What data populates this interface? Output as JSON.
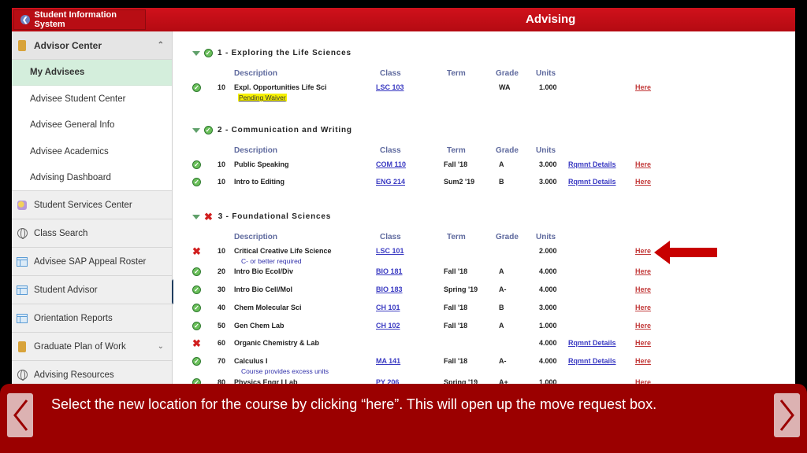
{
  "topbar": {
    "back_label": "Student Information System",
    "page_title": "Advising"
  },
  "sidebar": {
    "header": "Advisor Center",
    "sub_items": [
      {
        "label": "My Advisees",
        "active": true
      },
      {
        "label": "Advisee Student Center"
      },
      {
        "label": "Advisee General Info"
      },
      {
        "label": "Advisee Academics"
      },
      {
        "label": "Advising Dashboard"
      }
    ],
    "items": [
      {
        "label": "Student Services Center",
        "icon": "people-icon"
      },
      {
        "label": "Class Search",
        "icon": "globe-icon"
      },
      {
        "label": "Advisee SAP Appeal Roster",
        "icon": "grid-icon"
      },
      {
        "label": "Student Advisor",
        "icon": "grid-icon"
      },
      {
        "label": "Orientation Reports",
        "icon": "grid-icon"
      },
      {
        "label": "Graduate Plan of Work",
        "icon": "book-icon"
      },
      {
        "label": "Advising Resources",
        "icon": "globe-icon"
      }
    ],
    "collapse_label": "II"
  },
  "columns": {
    "description": "Description",
    "class": "Class",
    "term": "Term",
    "grade": "Grade",
    "units": "Units"
  },
  "requirements": [
    {
      "title": "1 - Exploring the Life Sciences",
      "status": "satisfied",
      "courses": [
        {
          "status": "satisfied",
          "seq": "10",
          "description": "Expl. Opportunities Life Sci",
          "class": "LSC 103",
          "term": "",
          "grade": "WA",
          "units": "1.000",
          "rqmnt": "",
          "here": "Here",
          "note": "Pending Waiver"
        }
      ]
    },
    {
      "title": "2 - Communication and Writing",
      "status": "satisfied",
      "courses": [
        {
          "status": "satisfied",
          "seq": "10",
          "description": "Public Speaking",
          "class": "COM 110",
          "term": "Fall '18",
          "grade": "A",
          "units": "3.000",
          "rqmnt": "Rqmnt Details",
          "here": "Here"
        },
        {
          "status": "satisfied",
          "seq": "10",
          "description": "Intro to Editing",
          "class": "ENG 214",
          "term": "Sum2 '19",
          "grade": "B",
          "units": "3.000",
          "rqmnt": "Rqmnt Details",
          "here": "Here"
        }
      ]
    },
    {
      "title": "3 - Foundational Sciences",
      "status": "not-satisfied",
      "courses": [
        {
          "status": "not-satisfied",
          "seq": "10",
          "description": "Critical Creative Life Science",
          "class": "LSC 101",
          "term": "",
          "grade": "",
          "units": "2.000",
          "rqmnt": "",
          "here": "Here",
          "note": "C- or better required"
        },
        {
          "status": "satisfied",
          "seq": "20",
          "description": "Intro Bio Ecol/Div",
          "class": "BIO 181",
          "term": "Fall '18",
          "grade": "A",
          "units": "4.000",
          "rqmnt": "",
          "here": "Here"
        },
        {
          "status": "satisfied",
          "seq": "30",
          "description": "Intro Bio Cell/Mol",
          "class": "BIO 183",
          "term": "Spring '19",
          "grade": "A-",
          "units": "4.000",
          "rqmnt": "",
          "here": "Here"
        },
        {
          "status": "satisfied",
          "seq": "40",
          "description": "Chem Molecular Sci",
          "class": "CH 101",
          "term": "Fall '18",
          "grade": "B",
          "units": "3.000",
          "rqmnt": "",
          "here": "Here"
        },
        {
          "status": "satisfied",
          "seq": "50",
          "description": "Gen Chem Lab",
          "class": "CH 102",
          "term": "Fall '18",
          "grade": "A",
          "units": "1.000",
          "rqmnt": "",
          "here": "Here"
        },
        {
          "status": "not-satisfied",
          "seq": "60",
          "description": "Organic Chemistry & Lab",
          "class": "",
          "term": "",
          "grade": "",
          "units": "4.000",
          "rqmnt": "Rqmnt Details",
          "here": "Here"
        },
        {
          "status": "satisfied",
          "seq": "70",
          "description": "Calculus I",
          "class": "MA 141",
          "term": "Fall '18",
          "grade": "A-",
          "units": "4.000",
          "rqmnt": "Rqmnt Details",
          "here": "Here",
          "note": "Course provides excess units"
        },
        {
          "status": "satisfied",
          "seq": "80",
          "description": "Physics Engr I Lab",
          "class": "PY 206",
          "term": "Spring '19",
          "grade": "A+",
          "units": "1.000",
          "rqmnt": "",
          "here": "Here"
        }
      ]
    }
  ],
  "banner": {
    "text": "Select the new location for the course by clicking “here”. This will open up the move request box.",
    "prev_label": "Previous",
    "next_label": "Next"
  },
  "colors": {
    "brand_red": "#c20e17",
    "banner_red": "#9b0000",
    "active_item": "#d4eedc",
    "link_blue": "#3a3ac2",
    "here_red": "#c23a3a"
  }
}
